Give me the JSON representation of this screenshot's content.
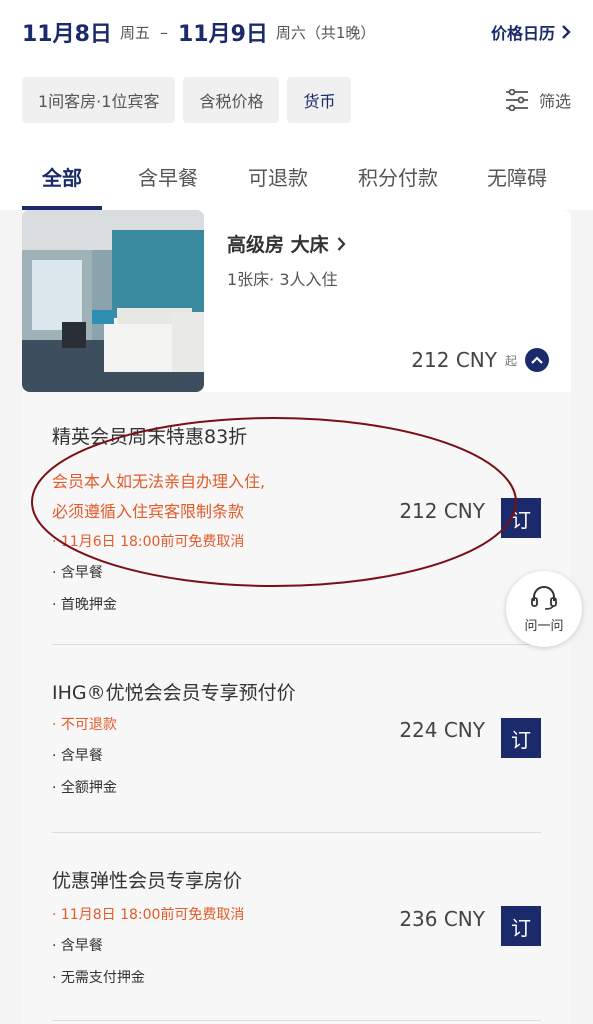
{
  "header": {
    "checkin_date": "11月8日",
    "checkin_week": "周五",
    "separator": "–",
    "checkout_date": "11月9日",
    "checkout_week": "周六（共1晚）",
    "price_calendar": "价格日历"
  },
  "filters": {
    "rooms_guests": "1间客房·1位宾客",
    "tax_price": "含税价格",
    "currency": "货币",
    "filter_label": "筛选"
  },
  "tabs": [
    "全部",
    "含早餐",
    "可退款",
    "积分付款",
    "无障碍"
  ],
  "room": {
    "name": "高级房 大床",
    "beds": "1张床· 3人入住",
    "from_price": "212 CNY",
    "from_suffix": "起"
  },
  "rates": [
    {
      "title": "精英会员周末特惠83折",
      "note1": "会员本人如无法亲自办理入住,",
      "note2": "必须遵循入住宾客限制条款",
      "cancel": "· 11月6日 18:00前可免费取消",
      "line1": "· 含早餐",
      "line2": "· 首晚押金",
      "price": "212 CNY",
      "book": "订"
    },
    {
      "title": "IHG®优悦会会员专享预付价",
      "cancel": "· 不可退款",
      "line1": "· 含早餐",
      "line2": "· 全额押金",
      "price": "224 CNY",
      "book": "订"
    },
    {
      "title": "优惠弹性会员专享房价",
      "cancel": "· 11月8日 18:00前可免费取消",
      "line1": "· 含早餐",
      "line2": "· 无需支付押金",
      "price": "236 CNY",
      "book": "订"
    }
  ],
  "support": {
    "label": "问一问"
  },
  "colors": {
    "brand": "#1b2a6b",
    "warning": "#e35b2a",
    "annotation": "#7a0f17"
  }
}
